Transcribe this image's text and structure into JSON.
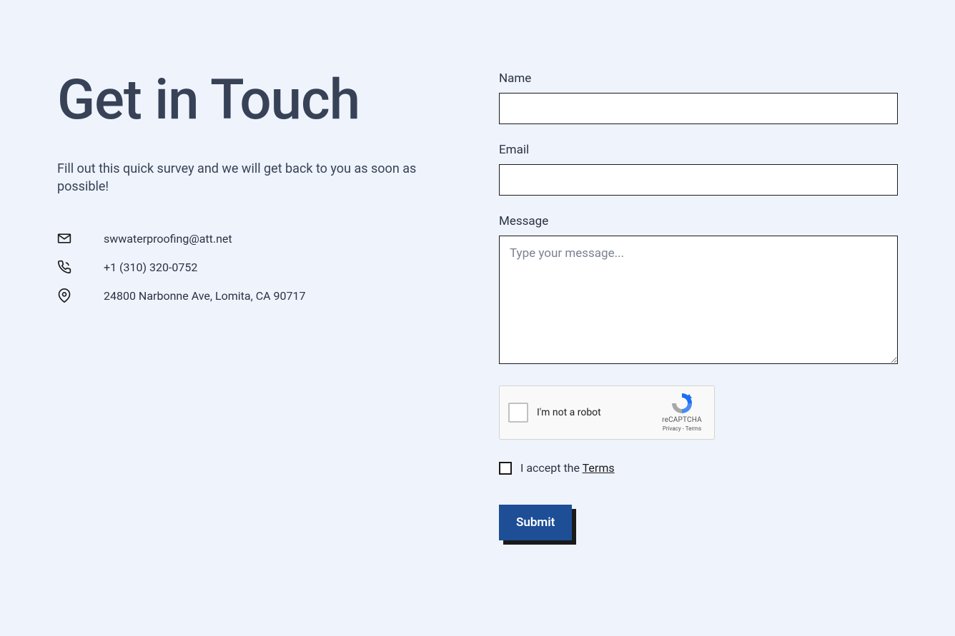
{
  "heading": "Get in Touch",
  "subheading": "Fill out this quick survey and we will get back to you as soon as possible!",
  "contact": {
    "email": "swwaterproofing@att.net",
    "phone": "+1 (310) 320-0752",
    "address": "24800 Narbonne Ave, Lomita, CA 90717"
  },
  "form": {
    "name": {
      "label": "Name",
      "value": ""
    },
    "email": {
      "label": "Email",
      "value": ""
    },
    "message": {
      "label": "Message",
      "placeholder": "Type your message...",
      "value": ""
    },
    "recaptcha": {
      "label": "I'm not a robot",
      "brand": "reCAPTCHA",
      "privacy": "Privacy",
      "terms": "Terms"
    },
    "terms": {
      "prefix": "I accept the ",
      "link_text": "Terms"
    },
    "submit_label": "Submit"
  }
}
